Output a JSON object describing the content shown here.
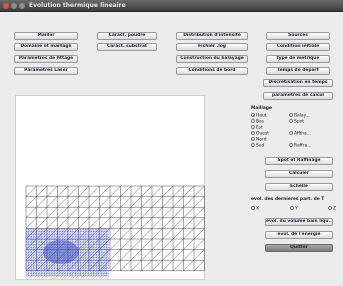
{
  "window": {
    "title": "Evolution thermique lineaire"
  },
  "buttons": {
    "mailler": "Mailler",
    "caract_poudre": "Caract. poudre",
    "distribution_intensite": "Distribution d'intensite",
    "sources": "Sources",
    "domaine_maillage": "Domaine et maillage",
    "caract_substrat": "Caract. substrat",
    "fichier_log": "Fichier .log",
    "condition_initiale": "Condition initiale",
    "parametres_fittage": "Parametres de fittage",
    "construction_balayage": "Construction du balayage",
    "type_metrique": "type de metrique",
    "parametres_laser": "Parametres Laser",
    "conditions_bord": "Conditions de bord",
    "temps_depart": "Temps de depart",
    "discretisation_temps": "Discretisation en temps",
    "parametre_calcul": "parametres de calcul",
    "spot_raffinage": "Spot et Raffinage",
    "calculer": "Calculer",
    "echelle": "Echelle",
    "evol_bain": "evol. du volume bain liqu...",
    "evol_energie": "evol. de l'energie",
    "quitter": "Quitter"
  },
  "maillage": {
    "label": "Maillage",
    "options": [
      {
        "label": "Haut",
        "selected": true
      },
      {
        "label": "Balay...",
        "selected": false
      },
      {
        "label": "Bas",
        "selected": false
      },
      {
        "label": "Spot",
        "selected": false
      },
      {
        "label": "Est",
        "selected": false
      },
      {
        "label": "Ouest",
        "selected": false
      },
      {
        "label": "Affiha...",
        "selected": false
      },
      {
        "label": "Nord",
        "selected": false
      },
      {
        "label": "Sud",
        "selected": false
      },
      {
        "label": "Raffra...",
        "selected": false
      }
    ]
  },
  "evol_temp": {
    "label": "evol. des dernieres part. de T",
    "options": [
      {
        "label": "X",
        "selected": false
      },
      {
        "label": "Y",
        "selected": false
      },
      {
        "label": "Z",
        "selected": false
      }
    ]
  },
  "colors": {
    "mesh_line": "#3a3a3a",
    "refined_mesh": "#2c3fb8",
    "canvas_bg": "#ffffff",
    "window_bg": "#ececec",
    "close_dot": "#d9572b"
  },
  "icons": [
    "close-icon",
    "minimize-icon",
    "maximize-icon"
  ]
}
